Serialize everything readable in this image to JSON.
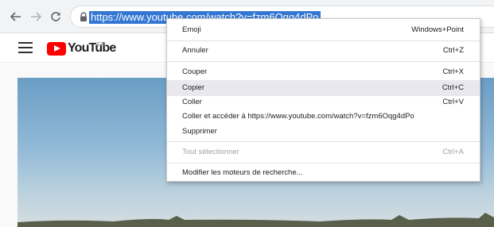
{
  "browser": {
    "url": "https://www.youtube.com/watch?v=fzm6Oqg4dPo"
  },
  "youtube": {
    "logo_text": "YouTube",
    "country_code": "FR"
  },
  "context_menu": {
    "items": [
      {
        "label": "Emoji",
        "shortcut": "Windows+Point"
      },
      {
        "label": "Annuler",
        "shortcut": "Ctrl+Z"
      },
      {
        "label": "Couper",
        "shortcut": "Ctrl+X"
      },
      {
        "label": "Copier",
        "shortcut": "Ctrl+C"
      },
      {
        "label": "Coller",
        "shortcut": "Ctrl+V"
      },
      {
        "label": "Coller et accéder à https://www.youtube.com/watch?v=fzm6Oqg4dPo",
        "shortcut": ""
      },
      {
        "label": "Supprimer",
        "shortcut": ""
      },
      {
        "label": "Tout sélectionner",
        "shortcut": "Ctrl+A"
      },
      {
        "label": "Modifier les moteurs de recherche...",
        "shortcut": ""
      }
    ],
    "highlighted_item": "Copier",
    "disabled_item": "Tout sélectionner"
  },
  "colors": {
    "selection": "#3477d2",
    "youtube_red": "#ff0000",
    "menu_highlight": "#e8e8ee"
  }
}
